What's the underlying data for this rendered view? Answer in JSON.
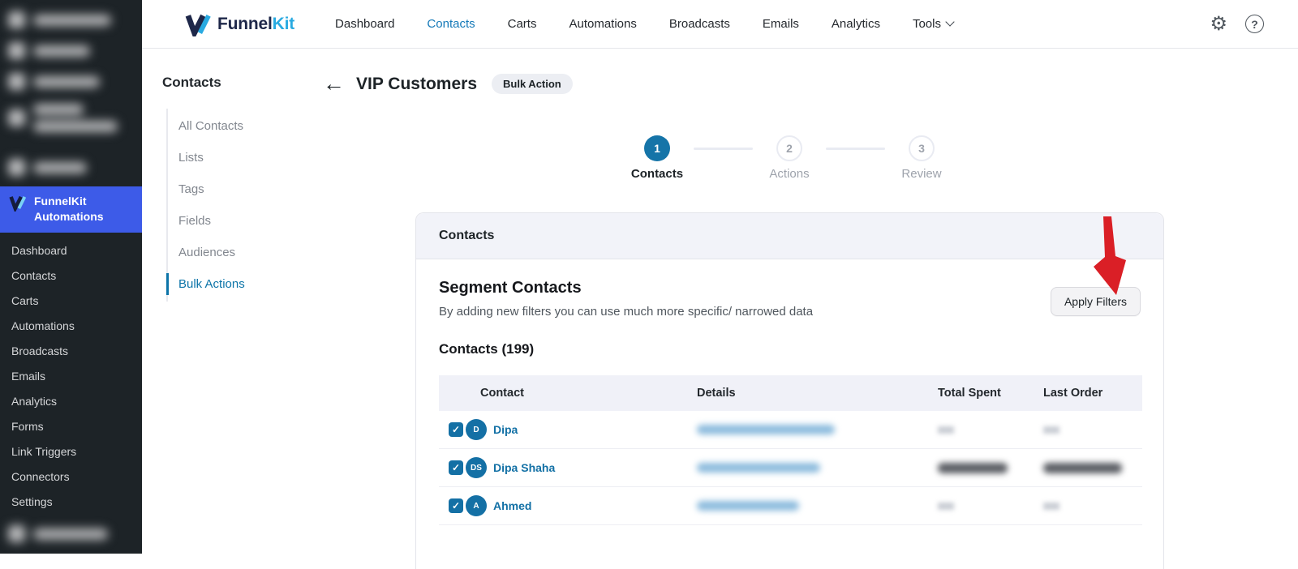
{
  "colors": {
    "wp_sidebar_bg": "#1d2327",
    "wp_active_blue": "#3d5be8",
    "accent_blue": "#1574a8",
    "top_nav_active": "#1479b8",
    "brand_navy": "#1e2749",
    "brand_lightblue": "#29aae1",
    "red_arrow": "#da1f26",
    "card_header_bg": "#f2f3f9",
    "table_header_bg": "#f0f1f8"
  },
  "icons": {
    "gear": "gear-icon",
    "help": "question-mark-icon",
    "back": "left-arrow-icon",
    "tools_chevron": "chevron-down-icon",
    "brand_mark": "funnelkit-logo-mark",
    "checkmark": "checkmark-icon",
    "annotation": "red-down-arrow"
  },
  "wp_sidebar": {
    "active_item": {
      "line1": "FunnelKit",
      "line2": "Automations"
    },
    "items": [
      "Dashboard",
      "Contacts",
      "Carts",
      "Automations",
      "Broadcasts",
      "Emails",
      "Analytics",
      "Forms",
      "Link Triggers",
      "Connectors",
      "Settings"
    ]
  },
  "top_nav": {
    "brand": {
      "funnel": "Funnel",
      "kit": "Kit"
    },
    "items": [
      {
        "label": "Dashboard"
      },
      {
        "label": "Contacts",
        "active": true
      },
      {
        "label": "Carts"
      },
      {
        "label": "Automations"
      },
      {
        "label": "Broadcasts"
      },
      {
        "label": "Emails"
      },
      {
        "label": "Analytics"
      },
      {
        "label": "Tools",
        "has_dropdown": true
      }
    ],
    "help_glyph": "?",
    "gear_glyph": "⚙"
  },
  "contacts_nav": {
    "title": "Contacts",
    "items": [
      "All Contacts",
      "Lists",
      "Tags",
      "Fields",
      "Audiences",
      "Bulk Actions"
    ],
    "active_item": "Bulk Actions"
  },
  "page_header": {
    "back_glyph": "←",
    "title": "VIP Customers",
    "badge": "Bulk Action"
  },
  "stepper": {
    "steps": [
      {
        "num": "1",
        "label": "Contacts",
        "state": "current"
      },
      {
        "num": "2",
        "label": "Actions",
        "state": "todo"
      },
      {
        "num": "3",
        "label": "Review",
        "state": "todo"
      }
    ]
  },
  "card": {
    "header": "Contacts",
    "section_title": "Segment Contacts",
    "section_subtitle": "By adding new filters you can use much more specific/ narrowed data",
    "apply_button": "Apply Filters",
    "table_title": "Contacts (199)",
    "table": {
      "columns": [
        "Contact",
        "Details",
        "Total Spent",
        "Last Order"
      ],
      "rows": [
        {
          "initials": "D",
          "name": "Dipa",
          "checked": true,
          "details": "redacted",
          "total_spent": "redacted",
          "last_order": "redacted"
        },
        {
          "initials": "DS",
          "name": "Dipa Shaha",
          "checked": true,
          "details": "redacted",
          "total_spent": "redacted",
          "last_order": "redacted"
        },
        {
          "initials": "A",
          "name": "Ahmed",
          "checked": true,
          "details": "redacted",
          "total_spent": "redacted",
          "last_order": "redacted"
        }
      ],
      "checkmark_glyph": "✓"
    }
  }
}
